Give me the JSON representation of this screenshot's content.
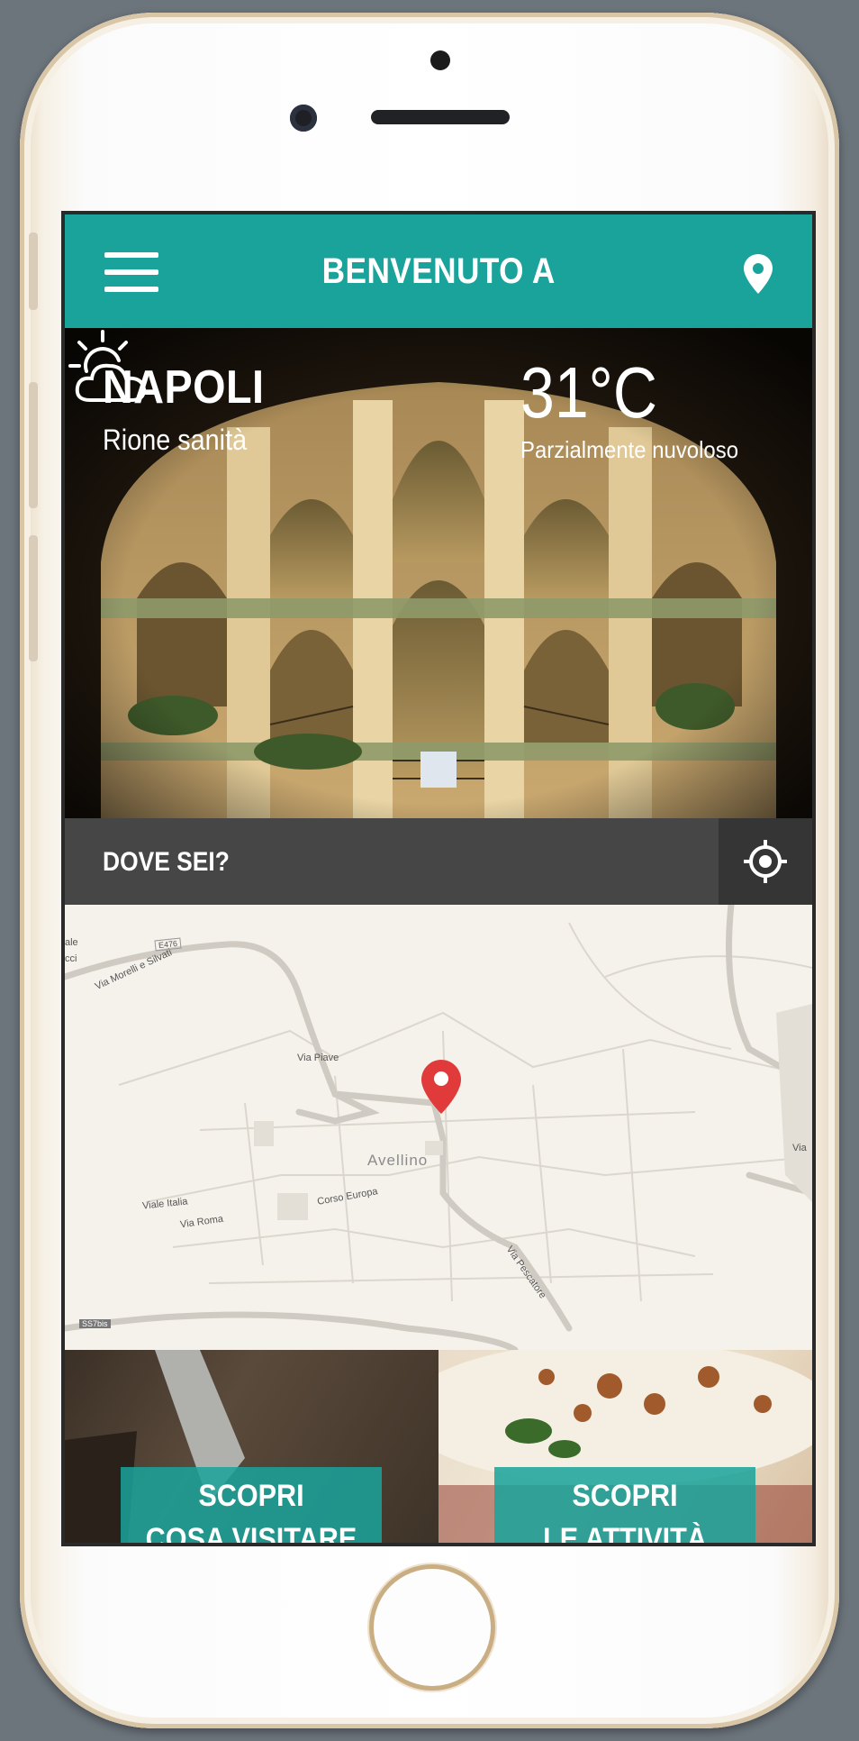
{
  "header": {
    "title": "BENVENUTO A"
  },
  "hero": {
    "city": "NAPOLI",
    "district": "Rione sanità",
    "temperature": "31°C",
    "condition": "Parzialmente nuvoloso"
  },
  "location_bar": {
    "label": "DOVE SEI?"
  },
  "map": {
    "city_label": "Avellino",
    "street_labels": [
      "Via Morelli e Silvati",
      "Via Piave",
      "Viale Italia",
      "Via Roma",
      "Corso Europa",
      "Via Pescatore",
      "ale",
      "cci",
      "Via",
      "E476",
      "SS7bis"
    ]
  },
  "cards": [
    {
      "line1": "SCOPRI",
      "line2": "COSA VISITARE"
    },
    {
      "line1": "SCOPRI",
      "line2": "LE ATTIVITÀ"
    }
  ],
  "colors": {
    "accent": "#1aa39b",
    "location_bar": "#464646",
    "map_pin": "#e03a3a"
  }
}
